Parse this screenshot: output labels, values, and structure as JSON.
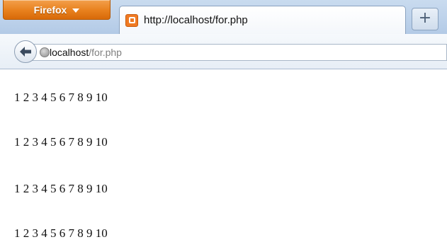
{
  "browser": {
    "menu_button_label": "Firefox",
    "tab": {
      "title": "http://localhost/for.php"
    },
    "new_tab_label": "+",
    "url": {
      "host": "localhost",
      "path": "/for.php"
    },
    "icons": [
      "back-arrow-icon",
      "globe-icon",
      "xampp-favicon-icon",
      "dropdown-arrow-icon"
    ],
    "colors": {
      "menu_button": "#e8801d",
      "chrome": "#c9dbef"
    }
  },
  "page": {
    "lines": [
      "1 2 3 4 5 6 7 8 9 10",
      "1 2 3 4 5 6 7 8 9 10",
      "1 2 3 4 5 6 7 8 9 10",
      "1 2 3 4 5 6 7 8 9 10"
    ]
  }
}
